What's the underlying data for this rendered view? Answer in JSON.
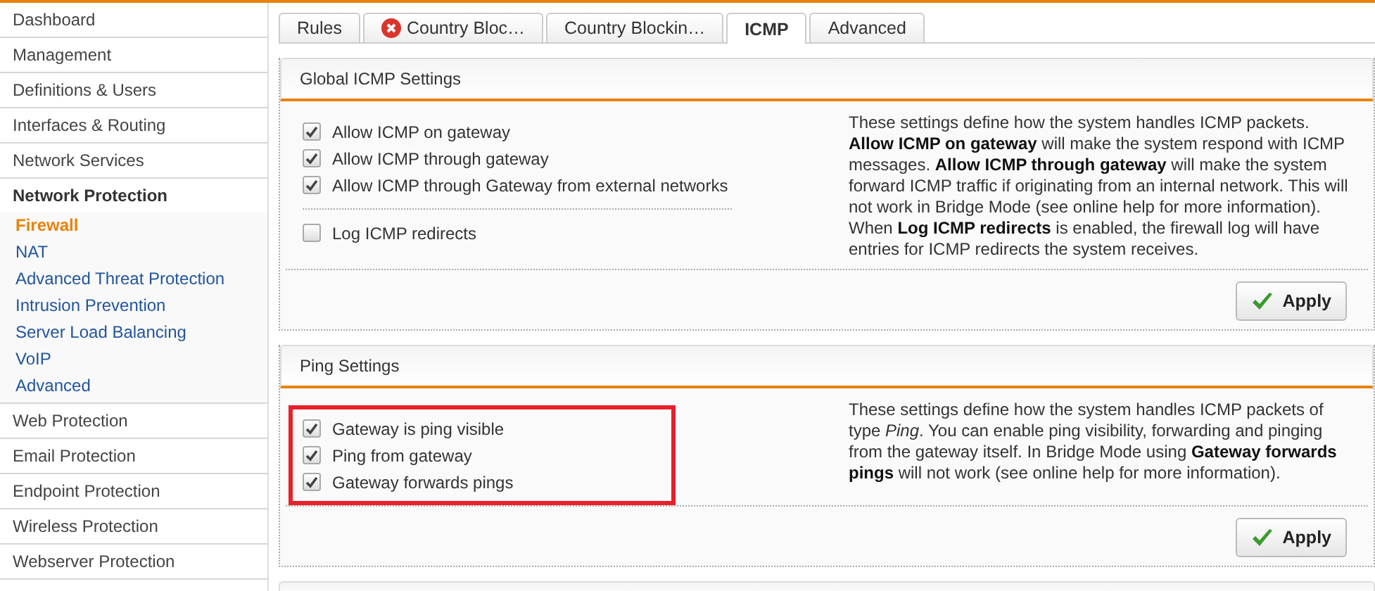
{
  "sidebar": {
    "items": [
      {
        "label": "Dashboard",
        "expanded": false
      },
      {
        "label": "Management",
        "expanded": false
      },
      {
        "label": "Definitions & Users",
        "expanded": false
      },
      {
        "label": "Interfaces & Routing",
        "expanded": false
      },
      {
        "label": "Network Services",
        "expanded": false
      },
      {
        "label": "Network Protection",
        "expanded": true,
        "children": [
          {
            "label": "Firewall",
            "selected": true
          },
          {
            "label": "NAT",
            "selected": false
          },
          {
            "label": "Advanced Threat Protection",
            "selected": false
          },
          {
            "label": "Intrusion Prevention",
            "selected": false
          },
          {
            "label": "Server Load Balancing",
            "selected": false
          },
          {
            "label": "VoIP",
            "selected": false
          },
          {
            "label": "Advanced",
            "selected": false
          }
        ]
      },
      {
        "label": "Web Protection",
        "expanded": false
      },
      {
        "label": "Email Protection",
        "expanded": false
      },
      {
        "label": "Endpoint Protection",
        "expanded": false
      },
      {
        "label": "Wireless Protection",
        "expanded": false
      },
      {
        "label": "Webserver Protection",
        "expanded": false
      }
    ]
  },
  "tabs": [
    {
      "label": "Rules",
      "selected": false
    },
    {
      "label": "Country Bloc…",
      "selected": false,
      "error": true
    },
    {
      "label": "Country Blockin…",
      "selected": false
    },
    {
      "label": "ICMP",
      "selected": true
    },
    {
      "label": "Advanced",
      "selected": false
    }
  ],
  "panels": [
    {
      "title": "Global ICMP Settings",
      "highlighted": false,
      "groups": [
        [
          {
            "label": "Allow ICMP on gateway",
            "checked": true
          },
          {
            "label": "Allow ICMP through gateway",
            "checked": true
          },
          {
            "label": "Allow ICMP through Gateway from external networks",
            "checked": true
          }
        ],
        [
          {
            "label": "Log ICMP redirects",
            "checked": false
          }
        ]
      ],
      "description": "These settings define how the system handles ICMP packets. **Allow ICMP on gateway** will make the system respond with ICMP messages. **Allow ICMP through gateway** will make the system forward ICMP traffic if originating from an internal network. This will not work in Bridge Mode (see online help for more information). When **Log ICMP redirects** is enabled, the firewall log will have entries for ICMP redirects the system receives.",
      "button": "Apply"
    },
    {
      "title": "Ping Settings",
      "highlighted": true,
      "groups": [
        [
          {
            "label": "Gateway is ping visible",
            "checked": true
          },
          {
            "label": "Ping from gateway",
            "checked": true
          },
          {
            "label": "Gateway forwards pings",
            "checked": true
          }
        ]
      ],
      "description": "These settings define how the system handles ICMP packets of type *Ping*. You can enable ping visibility, forwarding and pinging from the gateway itself. In Bridge Mode using **Gateway forwards pings** will not work (see online help for more information).",
      "button": "Apply"
    }
  ]
}
